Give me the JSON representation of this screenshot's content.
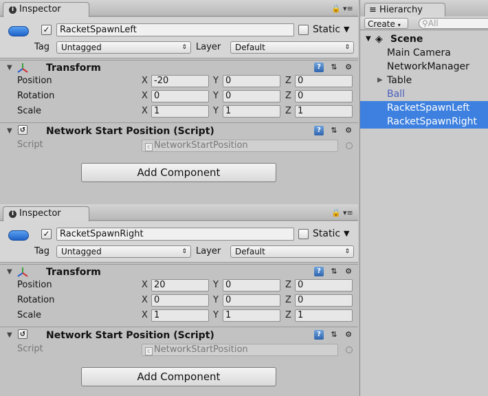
{
  "inspectors": [
    {
      "tab_label": "Inspector",
      "object": {
        "name": "RacketSpawnLeft",
        "active": true,
        "static_label": "Static",
        "static_checked": false
      },
      "tag_label": "Tag",
      "tag_value": "Untagged",
      "layer_label": "Layer",
      "layer_value": "Default",
      "transform": {
        "title": "Transform",
        "rows": [
          {
            "label": "Position",
            "x": "-20",
            "y": "0",
            "z": "0"
          },
          {
            "label": "Rotation",
            "x": "0",
            "y": "0",
            "z": "0"
          },
          {
            "label": "Scale",
            "x": "1",
            "y": "1",
            "z": "1"
          }
        ]
      },
      "network": {
        "title": "Network Start Position (Script)",
        "script_label": "Script",
        "script_value": "NetworkStartPosition"
      },
      "add_component": "Add Component"
    },
    {
      "tab_label": "Inspector",
      "object": {
        "name": "RacketSpawnRight",
        "active": true,
        "static_label": "Static",
        "static_checked": false
      },
      "tag_label": "Tag",
      "tag_value": "Untagged",
      "layer_label": "Layer",
      "layer_value": "Default",
      "transform": {
        "title": "Transform",
        "rows": [
          {
            "label": "Position",
            "x": "20",
            "y": "0",
            "z": "0"
          },
          {
            "label": "Rotation",
            "x": "0",
            "y": "0",
            "z": "0"
          },
          {
            "label": "Scale",
            "x": "1",
            "y": "1",
            "z": "1"
          }
        ]
      },
      "network": {
        "title": "Network Start Position (Script)",
        "script_label": "Script",
        "script_value": "NetworkStartPosition"
      },
      "add_component": "Add Component"
    }
  ],
  "axis_labels": {
    "x": "X",
    "y": "Y",
    "z": "Z"
  },
  "hierarchy": {
    "tab_label": "Hierarchy",
    "create_label": "Create",
    "search_placeholder": "All",
    "scene_label": "Scene",
    "items": [
      {
        "label": "Main Camera",
        "selected": false
      },
      {
        "label": "NetworkManager",
        "selected": false
      },
      {
        "label": "Table",
        "selected": false,
        "has_children": true
      },
      {
        "label": "Ball",
        "selected": false,
        "prefab": true
      },
      {
        "label": "RacketSpawnLeft",
        "selected": true
      },
      {
        "label": "RacketSpawnRight",
        "selected": true
      }
    ]
  },
  "colors": {
    "selection": "#3d80df",
    "prefab_text": "#4a5fbf",
    "panel_bg": "#c2c2c2"
  }
}
